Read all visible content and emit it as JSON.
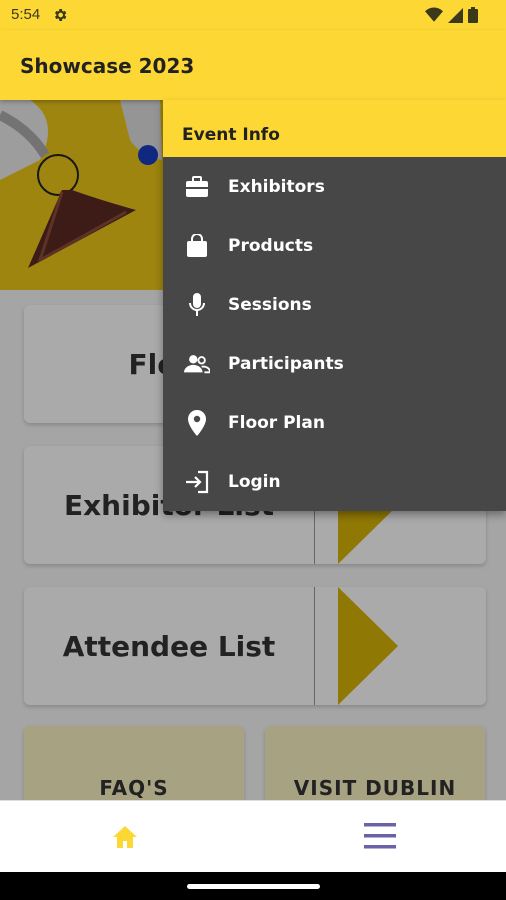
{
  "status_bar": {
    "time": "5:54"
  },
  "app_bar": {
    "title": "Showcase 2023"
  },
  "main": {
    "cards": [
      {
        "label": "Floor"
      },
      {
        "label": "Exhibitor List"
      },
      {
        "label": "Attendee List"
      }
    ],
    "tiles": [
      {
        "label": "FAQ'S"
      },
      {
        "label": "VISIT DUBLIN"
      }
    ]
  },
  "menu": {
    "header": "Event Info",
    "items": [
      {
        "label": "Exhibitors",
        "icon": "briefcase-icon"
      },
      {
        "label": "Products",
        "icon": "shopping-bag-icon"
      },
      {
        "label": "Sessions",
        "icon": "microphone-icon"
      },
      {
        "label": "Participants",
        "icon": "people-icon"
      },
      {
        "label": "Floor Plan",
        "icon": "location-pin-icon"
      },
      {
        "label": "Login",
        "icon": "login-icon"
      }
    ]
  },
  "bottom_nav": {
    "home_icon": "home-icon",
    "menu_icon": "hamburger-icon"
  },
  "colors": {
    "accent": "#fdd835",
    "menu_bg": "#474747",
    "arrow": "#d4b106",
    "nav_icon": "#6a62a8"
  }
}
